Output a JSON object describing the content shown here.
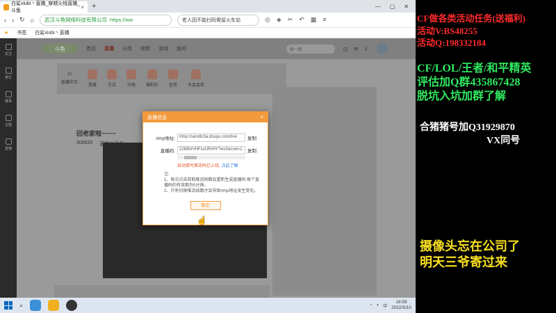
{
  "browser": {
    "active_tab": "白鲨xiubi丶直播_穿越火线直播_斗鱼",
    "tab_close": "×",
    "new_tab": "+",
    "url_site": "武汉斗鱼网络科技有限公司",
    "url_text": "https://ww",
    "news_text": "老人因不能扫码需留火车站",
    "bookmark_label": "书签",
    "bookmark_item": "白鲨xiubi丶直播"
  },
  "douyu": {
    "nav": [
      "首页",
      "直播",
      "分类",
      "视频",
      "游戏",
      "鱼吧"
    ],
    "search_placeholder": "搜一搜",
    "side_items": [
      "关注",
      "排行",
      "赛事",
      "主题",
      "直播"
    ],
    "categories": [
      "12",
      "直播中次",
      "英雄",
      "方式",
      "升级",
      "福利社",
      "任务",
      "大会金库"
    ],
    "stream_title": "回老家啦~~~~",
    "dashboard_label": "直播仪表盘",
    "hot_value": "308820"
  },
  "modal": {
    "title": "直播信息",
    "close": "×",
    "rtmp_label": "rtmp地址:",
    "rtmp_value": "rtmp://sendtc3a.douyu.com/live",
    "copy_label": "复制",
    "code_label": "直播码:",
    "code_value": "22690rVHFssURrHY?wsSecret=1",
    "warn_text": "自动填写推流码已上线,",
    "warn_link": "点此了解",
    "notes_title": "注:",
    "note1": "1、每次点击获取推流码都会重新生成直播码,每个直播码的有效期为5分钟。",
    "note2": "2、只有切换推流线路才会导致rtmp地址发生变化。",
    "ok_label": "确定"
  },
  "taskbar": {
    "search_icon": "search-icon",
    "tray_label": "中",
    "time": "16:59",
    "date": "2022/5/10"
  },
  "overlay": {
    "line1": "CF做各类活动任务(送福利)",
    "line2": "活动V:BS48255",
    "line3": "活动Q:198332184",
    "line4": "CF/LOL/王者/和平精英",
    "line5": "评估加Q群435867428",
    "line6": "脱坑入坑加群了解",
    "line7": "合猪猪号加Q31929870",
    "line8": "VX同号",
    "line9": "摄像头忘在公司了",
    "line10": "明天三爷寄过来"
  },
  "colors": {
    "accent": "#f39a3c",
    "warn": "#e8552d",
    "link": "#2a7de1",
    "overlay_red": "#ff2a2a",
    "overlay_green": "#30e860",
    "overlay_yellow": "#f8e020"
  }
}
